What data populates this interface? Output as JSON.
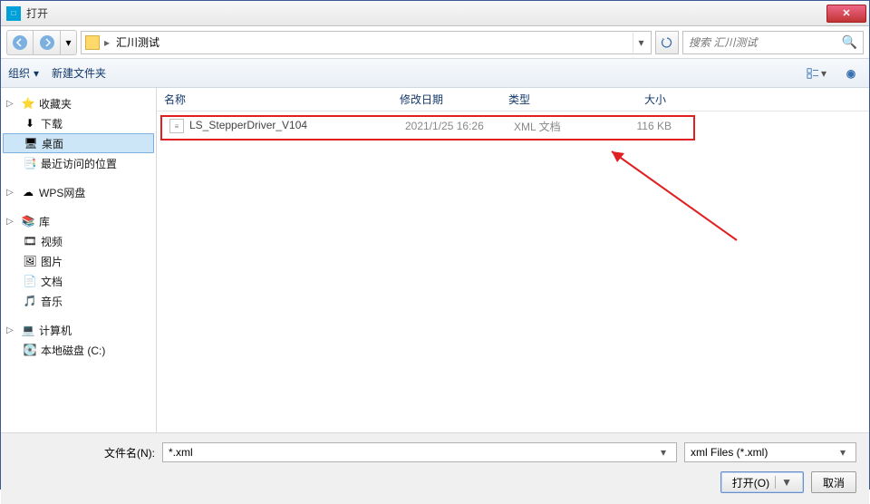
{
  "window": {
    "title": "打开"
  },
  "nav": {
    "breadcrumb": {
      "folder": "汇川测试"
    },
    "search_placeholder": "搜索 汇川测试"
  },
  "toolbar": {
    "organize": "组织",
    "newfolder": "新建文件夹"
  },
  "sidebar": {
    "favorites": {
      "label": "收藏夹",
      "items": [
        "下载",
        "桌面",
        "最近访问的位置"
      ]
    },
    "wps": {
      "label": "WPS网盘"
    },
    "libraries": {
      "label": "库",
      "items": [
        "视频",
        "图片",
        "文档",
        "音乐"
      ]
    },
    "computer": {
      "label": "计算机",
      "items": [
        "本地磁盘 (C:)"
      ]
    }
  },
  "columns": {
    "name": "名称",
    "date": "修改日期",
    "type": "类型",
    "size": "大小"
  },
  "files": [
    {
      "name": "LS_StepperDriver_V104",
      "date": "2021/1/25 16:26",
      "type": "XML 文档",
      "size": "116 KB"
    }
  ],
  "bottom": {
    "filename_label": "文件名(N):",
    "filename_value": "*.xml",
    "filter": "xml Files (*.xml)",
    "open": "打开(O)",
    "cancel": "取消"
  }
}
